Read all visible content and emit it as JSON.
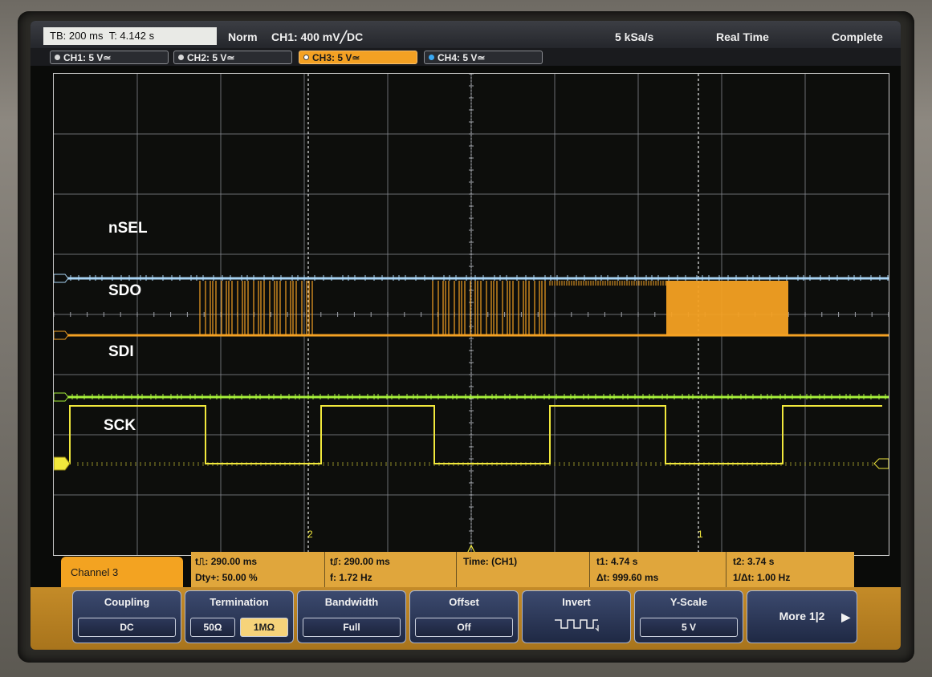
{
  "status_bar": {
    "timebase": "TB: 200 ms",
    "trigger_time": "T: 4.142 s",
    "mode": "Norm",
    "trigger_source": "CH1: 400 mV╱DC",
    "sample_rate": "5 kSa/s",
    "acq_mode": "Real Time",
    "acq_state": "Complete"
  },
  "channel_tabs": [
    {
      "label": "CH1: 5 V≃",
      "color": "#4fb0e8"
    },
    {
      "label": "CH2: 5 V≃",
      "color": "#e8e24a"
    },
    {
      "label": "CH3: 5 V≃",
      "color": "#f4a123"
    },
    {
      "label": "CH4: 5 V≃",
      "color": "#3aa8f2"
    }
  ],
  "traces": {
    "nsel": {
      "label": "nSEL",
      "color": "#a9d4f5"
    },
    "sdo": {
      "label": "SDO",
      "color": "#f4a123"
    },
    "sdi": {
      "label": "SDI",
      "color": "#a6f03a"
    },
    "sck": {
      "label": "SCK",
      "color": "#f1e83c"
    }
  },
  "cursor_markers": {
    "left": "2",
    "right": "1"
  },
  "measurements": {
    "panel_title": "Channel 3",
    "pulse_width_pos": "t⎍: 290.00 ms",
    "pulse_width_neg": "t⎎: 290.00 ms",
    "duty": "Dty+: 50.00 %",
    "frequency": "f: 1.72 Hz",
    "time_source": "Time:  (CH1)",
    "t1": "t1: 4.74 s",
    "delta_t": "Δt: 999.60 ms",
    "t2": "t2: 3.74 s",
    "inv_delta_t": "1/Δt: 1.00 Hz"
  },
  "menu": {
    "coupling": {
      "title": "Coupling",
      "value": "DC"
    },
    "termination": {
      "title": "Termination",
      "option_a": "50Ω",
      "option_b": "1MΩ"
    },
    "bandwidth": {
      "title": "Bandwidth",
      "value": "Full"
    },
    "offset": {
      "title": "Offset",
      "value": "Off"
    },
    "invert": {
      "title": "Invert"
    },
    "yscale": {
      "title": "Y-Scale",
      "value": "5 V"
    },
    "more": {
      "title": "More 1|2"
    }
  }
}
